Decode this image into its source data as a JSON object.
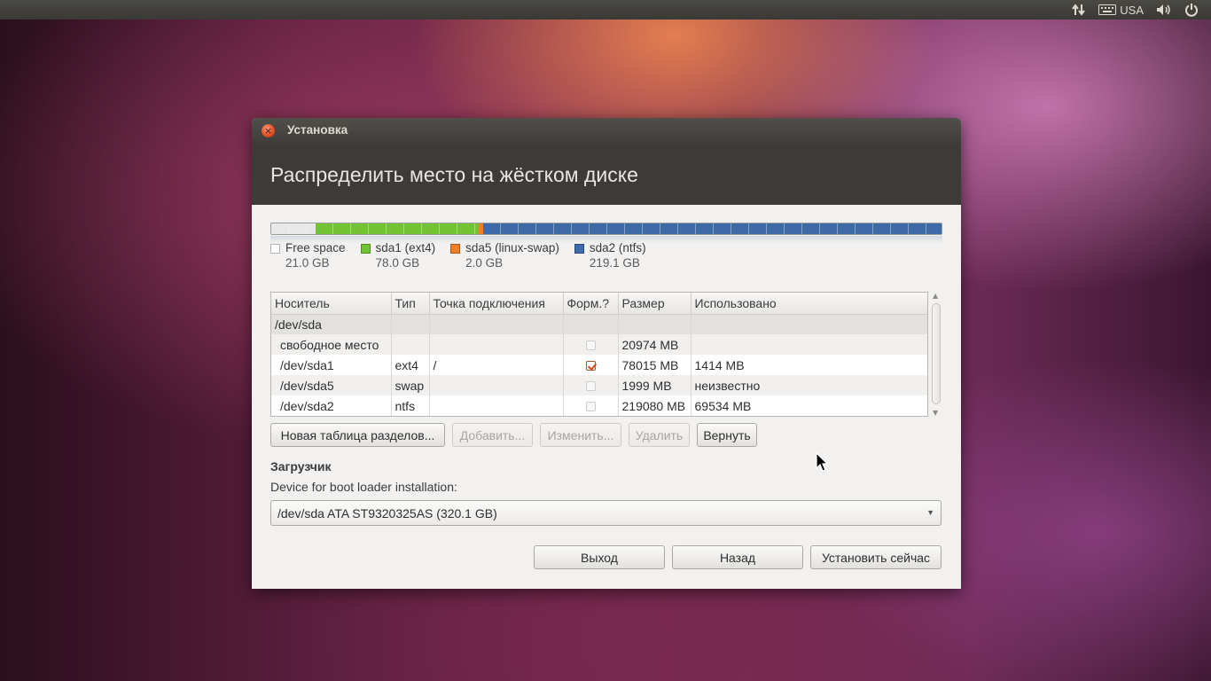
{
  "top_panel": {
    "keyboard_layout": "USA",
    "icons": [
      "network-arrows-icon",
      "keyboard-icon",
      "volume-icon",
      "power-icon"
    ]
  },
  "window": {
    "title": "Установка",
    "heading": "Распределить место на жёстком диске"
  },
  "partition_bar": {
    "segments": [
      {
        "name": "Free space",
        "size_gb": 21.0,
        "color": "#e8e8e8"
      },
      {
        "name": "sda1 (ext4)",
        "size_gb": 78.0,
        "color": "#73c435"
      },
      {
        "name": "sda5 (linux-swap)",
        "size_gb": 2.0,
        "color": "#ef7f26"
      },
      {
        "name": "sda2 (ntfs)",
        "size_gb": 219.1,
        "color": "#3e6aa8"
      }
    ]
  },
  "legend": [
    {
      "label": "Free space",
      "size": "21.0 GB",
      "color": "#ffffff"
    },
    {
      "label": "sda1 (ext4)",
      "size": "78.0 GB",
      "color": "#73c435"
    },
    {
      "label": "sda5 (linux-swap)",
      "size": "2.0 GB",
      "color": "#ef7f26"
    },
    {
      "label": "sda2 (ntfs)",
      "size": "219.1 GB",
      "color": "#3e6aa8"
    }
  ],
  "table": {
    "headers": [
      "Носитель",
      "Тип",
      "Точка подключения",
      "Форм.?",
      "Размер",
      "Использовано"
    ],
    "group": "/dev/sda",
    "rows": [
      {
        "device": "свободное место",
        "type": "",
        "mount": "",
        "format": false,
        "size": "20974 MB",
        "used": ""
      },
      {
        "device": "/dev/sda1",
        "type": "ext4",
        "mount": "/",
        "format": true,
        "size": "78015 MB",
        "used": "1414 MB"
      },
      {
        "device": "/dev/sda5",
        "type": "swap",
        "mount": "",
        "format": false,
        "size": "1999 MB",
        "used": "неизвестно"
      },
      {
        "device": "/dev/sda2",
        "type": "ntfs",
        "mount": "",
        "format": false,
        "size": "219080 MB",
        "used": "69534 MB"
      }
    ]
  },
  "buttons": {
    "new_table": "Новая таблица разделов...",
    "add": "Добавить...",
    "change": "Изменить...",
    "delete": "Удалить",
    "revert": "Вернуть"
  },
  "bootloader": {
    "section_label": "Загрузчик",
    "field_label": "Device for boot loader installation:",
    "selected": "/dev/sda ATA ST9320325AS (320.1 GB)"
  },
  "footer": {
    "quit": "Выход",
    "back": "Назад",
    "install": "Установить сейчас"
  }
}
